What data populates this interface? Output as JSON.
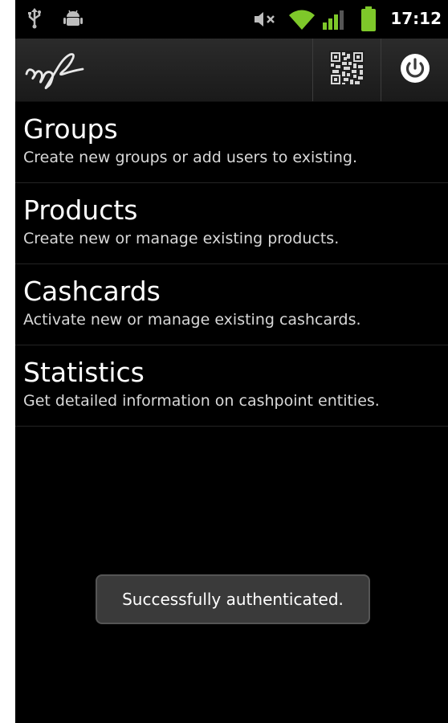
{
  "status_bar": {
    "time": "17:12",
    "icons": [
      "usb-icon",
      "android-debug-icon",
      "muted-volume-icon",
      "wifi-icon",
      "signal-icon",
      "battery-icon"
    ]
  },
  "action_bar": {
    "icons": [
      "app-logo",
      "qr-code-icon",
      "power-icon"
    ]
  },
  "menu": {
    "items": [
      {
        "title": "Groups",
        "subtitle": "Create new groups or add users to existing."
      },
      {
        "title": "Products",
        "subtitle": "Create new or manage existing products."
      },
      {
        "title": "Cashcards",
        "subtitle": "Activate new or manage existing cashcards."
      },
      {
        "title": "Statistics",
        "subtitle": "Get detailed information on cashpoint entities."
      }
    ]
  },
  "toast": {
    "message": "Successfully authenticated."
  },
  "colors": {
    "background": "#000000",
    "action_bar": "#222222",
    "wifi_green": "#7ec82a",
    "battery_green": "#7ec82a",
    "subtitle_text": "#d8d8d8",
    "toast_bg": "#3a3a3a"
  }
}
